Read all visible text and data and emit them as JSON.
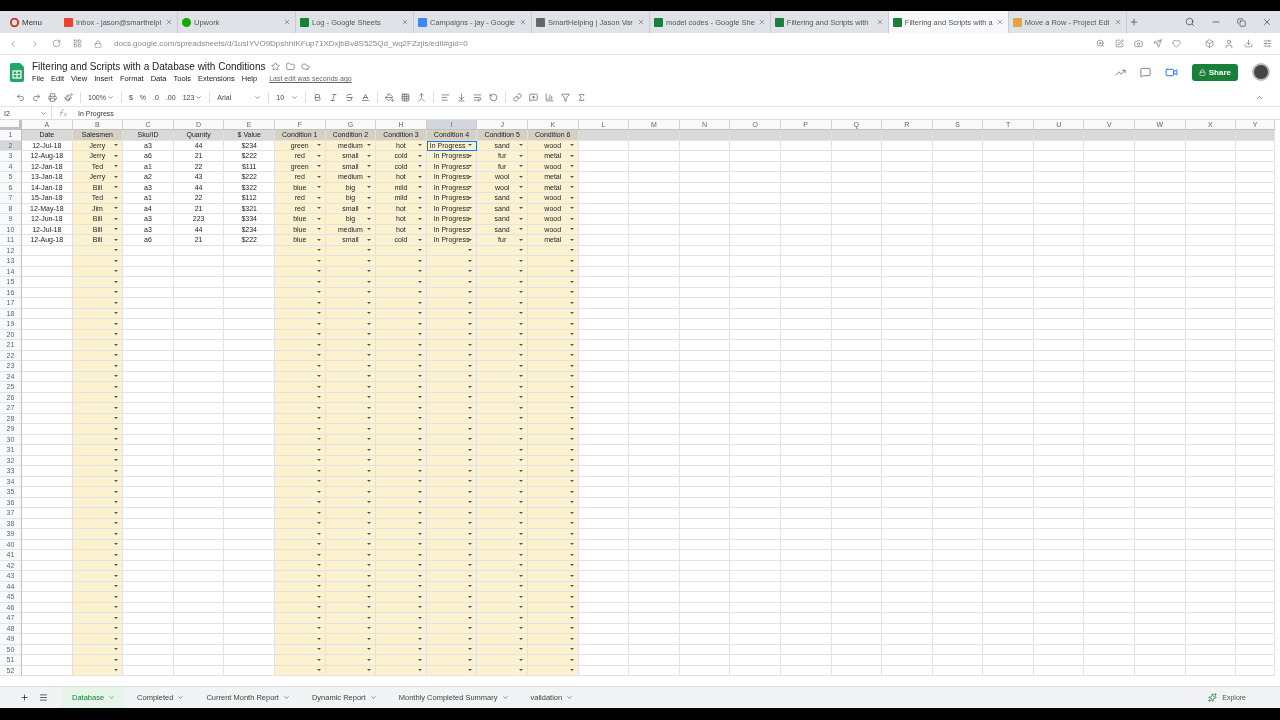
{
  "browser": {
    "menu": "Menu",
    "tabs": [
      {
        "kind": "mail",
        "title": "Inbox - jason@smarthelpi",
        "selected": false
      },
      {
        "kind": "upwork",
        "title": "Upwork",
        "selected": false
      },
      {
        "kind": "sheets",
        "title": "Log - Google Sheets",
        "selected": false
      },
      {
        "kind": "ads",
        "title": "Campaigns - jay - Google",
        "selected": false
      },
      {
        "kind": "site",
        "title": "SmartHelping | Jason Var",
        "selected": false
      },
      {
        "kind": "sheets",
        "title": "model codes - Google She",
        "selected": false
      },
      {
        "kind": "sheets",
        "title": "Filtering and Scripts with",
        "selected": false
      },
      {
        "kind": "sheets",
        "title": "Filtering and Scripts with a",
        "selected": true
      },
      {
        "kind": "pencil",
        "title": "Move a Row - Project Edi",
        "selected": false
      }
    ],
    "url": "docs.google.com/spreadsheets/d/1usIYVO9DpshhtKFup71XDxjbBv8S525Qd_wq2FZzjis/edit#gid=0"
  },
  "document": {
    "title": "Filtering and Scripts with a Database with Conditions",
    "menus": [
      "File",
      "Edit",
      "View",
      "Insert",
      "Format",
      "Data",
      "Tools",
      "Extensions",
      "Help"
    ],
    "last_edit": "Last edit was seconds ago",
    "share": "Share"
  },
  "toolbar": {
    "zoom": "100%",
    "currency": "$",
    "percent": "%",
    "decrease_decimals": ".0",
    "increase_decimals": ".00",
    "number_format": "123",
    "font": "Arial",
    "font_size": "10"
  },
  "formula_bar": {
    "cell": "I2",
    "value": "In Progress"
  },
  "columns": [
    {
      "letter": "A",
      "validated": false,
      "selected": false
    },
    {
      "letter": "B",
      "validated": true,
      "selected": false
    },
    {
      "letter": "C",
      "validated": false,
      "selected": false
    },
    {
      "letter": "D",
      "validated": false,
      "selected": false
    },
    {
      "letter": "E",
      "validated": false,
      "selected": false
    },
    {
      "letter": "F",
      "validated": true,
      "selected": false
    },
    {
      "letter": "G",
      "validated": true,
      "selected": false
    },
    {
      "letter": "H",
      "validated": true,
      "selected": false
    },
    {
      "letter": "I",
      "validated": true,
      "selected": true
    },
    {
      "letter": "J",
      "validated": true,
      "selected": false
    },
    {
      "letter": "K",
      "validated": true,
      "selected": false
    },
    {
      "letter": "L",
      "validated": false,
      "selected": false
    },
    {
      "letter": "M",
      "validated": false,
      "selected": false
    },
    {
      "letter": "N",
      "validated": false,
      "selected": false
    },
    {
      "letter": "O",
      "validated": false,
      "selected": false
    },
    {
      "letter": "P",
      "validated": false,
      "selected": false
    },
    {
      "letter": "Q",
      "validated": false,
      "selected": false
    },
    {
      "letter": "R",
      "validated": false,
      "selected": false
    },
    {
      "letter": "S",
      "validated": false,
      "selected": false
    },
    {
      "letter": "T",
      "validated": false,
      "selected": false
    },
    {
      "letter": "U",
      "validated": false,
      "selected": false
    },
    {
      "letter": "V",
      "validated": false,
      "selected": false
    },
    {
      "letter": "W",
      "validated": false,
      "selected": false
    },
    {
      "letter": "X",
      "validated": false,
      "selected": false
    },
    {
      "letter": "Y",
      "validated": false,
      "selected": false
    }
  ],
  "rows": [
    {
      "number": "1",
      "kind": "header",
      "selected": false,
      "cells": [
        "Date",
        "Salesmen",
        "Sku/ID",
        "Quanity",
        "$ Value",
        "Condition 1",
        "Condition 2",
        "Condition 3",
        "Condition 4",
        "Condition 5",
        "Condition 6"
      ]
    },
    {
      "number": "2",
      "kind": "data",
      "selected": true,
      "cells": [
        "12-Jul-18",
        "Jerry",
        "a3",
        "44",
        "$234",
        "green",
        "medium",
        "hot",
        "In Progress",
        "sand",
        "wood"
      ]
    },
    {
      "number": "3",
      "kind": "data",
      "selected": false,
      "cells": [
        "12-Aug-18",
        "Jerry",
        "a6",
        "21",
        "$222",
        "red",
        "small",
        "cold",
        "In Progress",
        "fur",
        "metal"
      ]
    },
    {
      "number": "4",
      "kind": "data",
      "selected": false,
      "cells": [
        "12-Jan-18",
        "Ted",
        "a1",
        "22",
        "$111",
        "green",
        "small",
        "cold",
        "In Progress",
        "fur",
        "wood"
      ]
    },
    {
      "number": "5",
      "kind": "data",
      "selected": false,
      "cells": [
        "13-Jan-18",
        "Jerry",
        "a2",
        "43",
        "$222",
        "red",
        "medium",
        "hot",
        "In Progress",
        "wool",
        "metal"
      ]
    },
    {
      "number": "6",
      "kind": "data",
      "selected": false,
      "cells": [
        "14-Jan-18",
        "Bill",
        "a3",
        "44",
        "$322",
        "blue",
        "big",
        "mild",
        "In Progress",
        "wool",
        "metal"
      ]
    },
    {
      "number": "7",
      "kind": "data",
      "selected": false,
      "cells": [
        "15-Jan-18",
        "Ted",
        "a1",
        "22",
        "$112",
        "red",
        "big",
        "mild",
        "In Progress",
        "sand",
        "wood"
      ]
    },
    {
      "number": "8",
      "kind": "data",
      "selected": false,
      "cells": [
        "12-May-18",
        "Jim",
        "a4",
        "21",
        "$321",
        "red",
        "small",
        "hot",
        "In Progress",
        "sand",
        "wood"
      ]
    },
    {
      "number": "9",
      "kind": "data",
      "selected": false,
      "cells": [
        "12-Jun-18",
        "Bill",
        "a3",
        "223",
        "$334",
        "blue",
        "big",
        "hot",
        "In Progress",
        "sand",
        "wood"
      ]
    },
    {
      "number": "10",
      "kind": "data",
      "selected": false,
      "cells": [
        "12-Jul-18",
        "Bill",
        "a3",
        "44",
        "$234",
        "blue",
        "medium",
        "hot",
        "In Progress",
        "sand",
        "wood"
      ]
    },
    {
      "number": "11",
      "kind": "data",
      "selected": false,
      "cells": [
        "12-Aug-18",
        "Bill",
        "a6",
        "21",
        "$222",
        "blue",
        "small",
        "cold",
        "In Progress",
        "fur",
        "metal"
      ]
    },
    {
      "number": "12",
      "kind": "empty",
      "selected": false
    },
    {
      "number": "13",
      "kind": "empty",
      "selected": false
    },
    {
      "number": "14",
      "kind": "empty",
      "selected": false
    },
    {
      "number": "15",
      "kind": "empty",
      "selected": false
    },
    {
      "number": "16",
      "kind": "empty",
      "selected": false
    },
    {
      "number": "17",
      "kind": "empty",
      "selected": false
    },
    {
      "number": "18",
      "kind": "empty",
      "selected": false
    },
    {
      "number": "19",
      "kind": "empty",
      "selected": false
    },
    {
      "number": "20",
      "kind": "empty",
      "selected": false
    },
    {
      "number": "21",
      "kind": "empty",
      "selected": false
    },
    {
      "number": "22",
      "kind": "empty",
      "selected": false
    },
    {
      "number": "23",
      "kind": "empty",
      "selected": false
    },
    {
      "number": "24",
      "kind": "empty",
      "selected": false
    },
    {
      "number": "25",
      "kind": "empty",
      "selected": false
    },
    {
      "number": "26",
      "kind": "empty",
      "selected": false
    },
    {
      "number": "27",
      "kind": "empty",
      "selected": false
    },
    {
      "number": "28",
      "kind": "empty",
      "selected": false
    },
    {
      "number": "29",
      "kind": "empty",
      "selected": false
    },
    {
      "number": "30",
      "kind": "empty",
      "selected": false
    },
    {
      "number": "31",
      "kind": "empty",
      "selected": false
    },
    {
      "number": "32",
      "kind": "empty",
      "selected": false
    },
    {
      "number": "33",
      "kind": "empty",
      "selected": false
    },
    {
      "number": "34",
      "kind": "empty",
      "selected": false
    },
    {
      "number": "35",
      "kind": "empty",
      "selected": false
    },
    {
      "number": "36",
      "kind": "empty",
      "selected": false
    },
    {
      "number": "37",
      "kind": "empty",
      "selected": false
    },
    {
      "number": "38",
      "kind": "empty",
      "selected": false
    },
    {
      "number": "39",
      "kind": "empty",
      "selected": false
    },
    {
      "number": "40",
      "kind": "empty",
      "selected": false
    },
    {
      "number": "41",
      "kind": "empty",
      "selected": false
    },
    {
      "number": "42",
      "kind": "empty",
      "selected": false
    },
    {
      "number": "43",
      "kind": "empty",
      "selected": false
    },
    {
      "number": "44",
      "kind": "empty",
      "selected": false
    },
    {
      "number": "45",
      "kind": "empty",
      "selected": false
    },
    {
      "number": "46",
      "kind": "empty",
      "selected": false
    },
    {
      "number": "47",
      "kind": "empty",
      "selected": false
    },
    {
      "number": "48",
      "kind": "empty",
      "selected": false
    },
    {
      "number": "49",
      "kind": "empty",
      "selected": false
    },
    {
      "number": "50",
      "kind": "empty",
      "selected": false
    },
    {
      "number": "51",
      "kind": "empty",
      "selected": false
    },
    {
      "number": "52",
      "kind": "empty",
      "selected": false
    }
  ],
  "sheets": [
    {
      "name": "Database",
      "selected": true
    },
    {
      "name": "Completed",
      "selected": false
    },
    {
      "name": "Current Month Report",
      "selected": false
    },
    {
      "name": "Dynamic Report",
      "selected": false
    },
    {
      "name": "Monthly Completed Summary",
      "selected": false
    },
    {
      "name": "validation",
      "selected": false
    }
  ],
  "explore": "Explore"
}
